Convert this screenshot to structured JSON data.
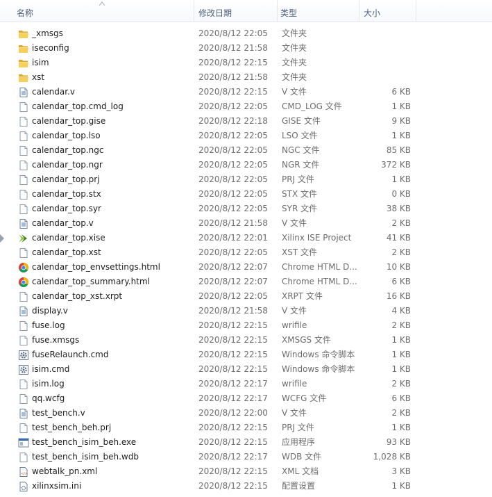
{
  "columns": {
    "name": "名称",
    "date": "修改日期",
    "type": "类型",
    "size": "大小"
  },
  "files": [
    {
      "name": "_xmsgs",
      "date": "2020/8/12 22:05",
      "type": "文件夹",
      "size": "",
      "icon": "folder-icon"
    },
    {
      "name": "iseconfig",
      "date": "2020/8/12 21:58",
      "type": "文件夹",
      "size": "",
      "icon": "folder-icon"
    },
    {
      "name": "isim",
      "date": "2020/8/12 22:15",
      "type": "文件夹",
      "size": "",
      "icon": "folder-icon"
    },
    {
      "name": "xst",
      "date": "2020/8/12 21:58",
      "type": "文件夹",
      "size": "",
      "icon": "folder-icon"
    },
    {
      "name": "calendar.v",
      "date": "2020/8/12 22:15",
      "type": "V 文件",
      "size": "6 KB",
      "icon": "text-file-icon"
    },
    {
      "name": "calendar_top.cmd_log",
      "date": "2020/8/12 22:05",
      "type": "CMD_LOG 文件",
      "size": "1 KB",
      "icon": "file-icon"
    },
    {
      "name": "calendar_top.gise",
      "date": "2020/8/12 22:18",
      "type": "GISE 文件",
      "size": "9 KB",
      "icon": "file-icon"
    },
    {
      "name": "calendar_top.lso",
      "date": "2020/8/12 22:05",
      "type": "LSO 文件",
      "size": "1 KB",
      "icon": "file-icon"
    },
    {
      "name": "calendar_top.ngc",
      "date": "2020/8/12 22:05",
      "type": "NGC 文件",
      "size": "85 KB",
      "icon": "file-icon"
    },
    {
      "name": "calendar_top.ngr",
      "date": "2020/8/12 22:05",
      "type": "NGR 文件",
      "size": "372 KB",
      "icon": "file-icon"
    },
    {
      "name": "calendar_top.prj",
      "date": "2020/8/12 22:05",
      "type": "PRJ 文件",
      "size": "1 KB",
      "icon": "file-icon"
    },
    {
      "name": "calendar_top.stx",
      "date": "2020/8/12 22:05",
      "type": "STX 文件",
      "size": "0 KB",
      "icon": "file-icon"
    },
    {
      "name": "calendar_top.syr",
      "date": "2020/8/12 22:05",
      "type": "SYR 文件",
      "size": "38 KB",
      "icon": "file-icon"
    },
    {
      "name": "calendar_top.v",
      "date": "2020/8/12 21:58",
      "type": "V 文件",
      "size": "2 KB",
      "icon": "text-file-icon"
    },
    {
      "name": "calendar_top.xise",
      "date": "2020/8/12 22:01",
      "type": "Xilinx ISE Project",
      "size": "41 KB",
      "icon": "xilinx-ise-icon"
    },
    {
      "name": "calendar_top.xst",
      "date": "2020/8/12 22:05",
      "type": "XST 文件",
      "size": "2 KB",
      "icon": "file-icon"
    },
    {
      "name": "calendar_top_envsettings.html",
      "date": "2020/8/12 22:07",
      "type": "Chrome HTML D...",
      "size": "10 KB",
      "icon": "chrome-icon"
    },
    {
      "name": "calendar_top_summary.html",
      "date": "2020/8/12 22:07",
      "type": "Chrome HTML D...",
      "size": "6 KB",
      "icon": "chrome-icon"
    },
    {
      "name": "calendar_top_xst.xrpt",
      "date": "2020/8/12 22:05",
      "type": "XRPT 文件",
      "size": "16 KB",
      "icon": "file-icon"
    },
    {
      "name": "display.v",
      "date": "2020/8/12 21:58",
      "type": "V 文件",
      "size": "4 KB",
      "icon": "text-file-icon"
    },
    {
      "name": "fuse.log",
      "date": "2020/8/12 22:15",
      "type": "wrifile",
      "size": "2 KB",
      "icon": "file-icon"
    },
    {
      "name": "fuse.xmsgs",
      "date": "2020/8/12 22:15",
      "type": "XMSGS 文件",
      "size": "1 KB",
      "icon": "file-icon"
    },
    {
      "name": "fuseRelaunch.cmd",
      "date": "2020/8/12 22:15",
      "type": "Windows 命令脚本",
      "size": "1 KB",
      "icon": "gear-script-icon"
    },
    {
      "name": "isim.cmd",
      "date": "2020/8/12 22:15",
      "type": "Windows 命令脚本",
      "size": "1 KB",
      "icon": "gear-script-icon"
    },
    {
      "name": "isim.log",
      "date": "2020/8/12 22:17",
      "type": "wrifile",
      "size": "2 KB",
      "icon": "file-icon"
    },
    {
      "name": "qq.wcfg",
      "date": "2020/8/12 22:17",
      "type": "WCFG 文件",
      "size": "6 KB",
      "icon": "file-icon"
    },
    {
      "name": "test_bench.v",
      "date": "2020/8/12 22:00",
      "type": "V 文件",
      "size": "2 KB",
      "icon": "text-file-icon"
    },
    {
      "name": "test_bench_beh.prj",
      "date": "2020/8/12 22:15",
      "type": "PRJ 文件",
      "size": "1 KB",
      "icon": "file-icon"
    },
    {
      "name": "test_bench_isim_beh.exe",
      "date": "2020/8/12 22:15",
      "type": "应用程序",
      "size": "93 KB",
      "icon": "exe-icon"
    },
    {
      "name": "test_bench_isim_beh.wdb",
      "date": "2020/8/12 22:17",
      "type": "WDB 文件",
      "size": "1,028 KB",
      "icon": "file-icon"
    },
    {
      "name": "webtalk_pn.xml",
      "date": "2020/8/12 22:15",
      "type": "XML 文档",
      "size": "3 KB",
      "icon": "xml-icon"
    },
    {
      "name": "xilinxsim.ini",
      "date": "2020/8/12 22:15",
      "type": "配置设置",
      "size": "1 KB",
      "icon": "ini-icon"
    }
  ]
}
